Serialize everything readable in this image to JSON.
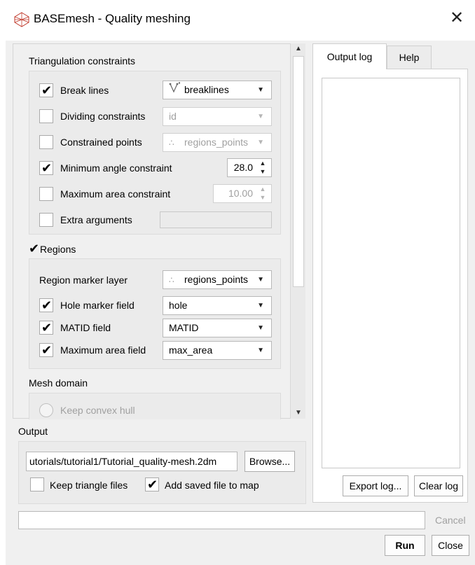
{
  "window": {
    "title": "BASEmesh - Quality meshing",
    "close_glyph": "✕",
    "app_icon": "mesh-grid-icon"
  },
  "constraints": {
    "heading": "Triangulation constraints",
    "break_lines": {
      "label": "Break lines",
      "checked": true,
      "value": "breaklines",
      "layer_icon": "line-layer-icon"
    },
    "dividing": {
      "label": "Dividing constraints",
      "checked": false,
      "value": "id"
    },
    "constrained_points": {
      "label": "Constrained points",
      "checked": false,
      "value": "regions_points",
      "layer_icon": "point-layer-icon"
    },
    "min_angle": {
      "label": "Minimum angle constraint",
      "checked": true,
      "value": "28.0"
    },
    "max_area": {
      "label": "Maximum area constraint",
      "checked": false,
      "value": "10.00"
    },
    "extra_args": {
      "label": "Extra arguments",
      "checked": false,
      "value": ""
    }
  },
  "regions": {
    "heading": "Regions",
    "checked": true,
    "marker_layer": {
      "label": "Region marker layer",
      "value": "regions_points",
      "layer_icon": "point-layer-icon"
    },
    "hole_marker": {
      "label": "Hole marker field",
      "checked": true,
      "value": "hole"
    },
    "matid": {
      "label": "MATID field",
      "checked": true,
      "value": "MATID"
    },
    "max_area_field": {
      "label": "Maximum area field",
      "checked": true,
      "value": "max_area"
    }
  },
  "mesh_domain": {
    "heading": "Mesh domain",
    "keep_convex_hull": "Keep convex hull"
  },
  "output": {
    "heading": "Output",
    "path": "utorials/tutorial1/Tutorial_quality-mesh.2dm",
    "browse": "Browse...",
    "keep_triangle": {
      "label": "Keep triangle files",
      "checked": false
    },
    "add_to_map": {
      "label": "Add saved file to map",
      "checked": true
    }
  },
  "tabs": {
    "output_log": "Output log",
    "help": "Help",
    "active": "output_log"
  },
  "log": {
    "export": "Export log...",
    "clear": "Clear log"
  },
  "footer": {
    "cancel": "Cancel",
    "run": "Run",
    "close": "Close",
    "progress": 0
  },
  "glyphs": {
    "check": "✔",
    "combo_arrow": "▼",
    "spin_up": "▲",
    "spin_down": "▼",
    "scroll_up": "▲",
    "scroll_down": "▼"
  },
  "colors": {
    "dialog_bg": "#f0f0f0",
    "group_bg": "#ebebeb",
    "disabled_text": "#a0a0a0"
  }
}
